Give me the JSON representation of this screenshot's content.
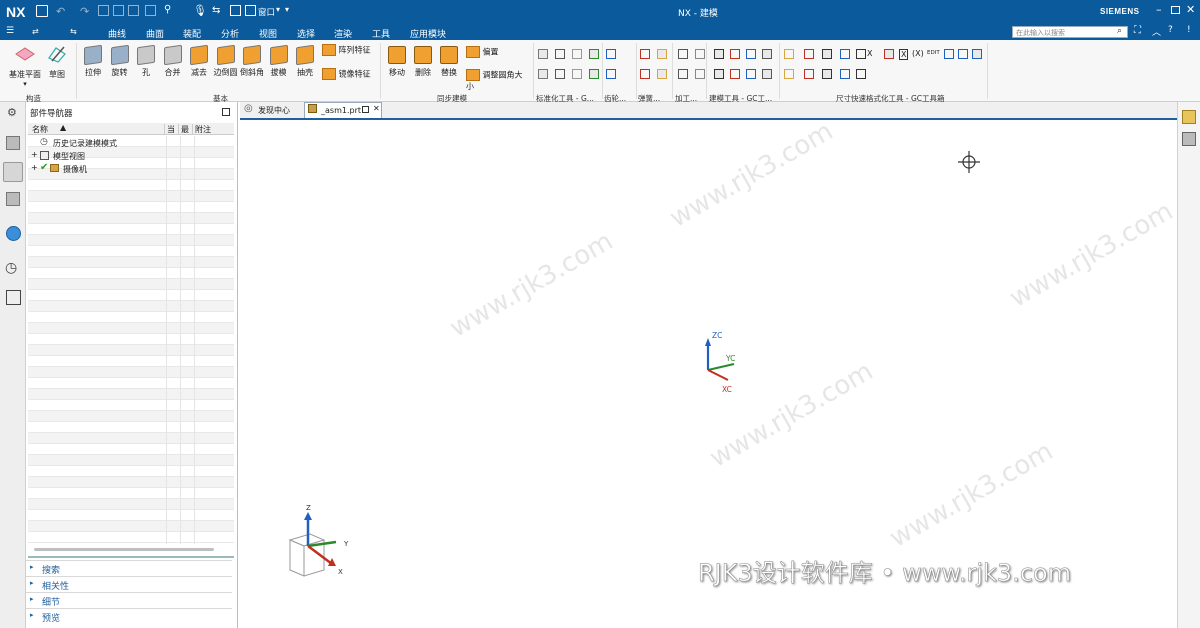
{
  "titlebar": {
    "logo": "NX",
    "title": "NX - 建模",
    "brand": "SIEMENS",
    "window_menu": "窗口"
  },
  "menubar": {
    "items": [
      "曲线",
      "曲面",
      "装配",
      "分析",
      "视图",
      "选择",
      "渲染",
      "工具",
      "应用模块"
    ],
    "search_placeholder": "在此输入以搜索"
  },
  "ribbon": {
    "datum": {
      "label": "基准平面"
    },
    "sketch": {
      "label": "草图"
    },
    "group_construct": "构造",
    "basic": [
      "拉伸",
      "旋转",
      "孔",
      "合并",
      "减去",
      "边倒圆",
      "倒斜角",
      "拔模",
      "抽壳"
    ],
    "pattern": "阵列特征",
    "mirror": "镜像特征",
    "group_basic": "基本",
    "sync": [
      "移动",
      "删除",
      "替换"
    ],
    "offset": "偏置",
    "resize_blend": "调整圆角大小",
    "group_sync": "同步建模",
    "group_std": "标准化工具 - G...",
    "group_gear": "齿轮...",
    "group_spring": "弹簧...",
    "group_machining": "加工...",
    "group_modeling_gc": "建模工具 - GC工...",
    "group_dim_gc": "尺寸快速格式化工具 - GC工具箱",
    "dim_labels": [
      "X",
      "(X)",
      "EDIT"
    ]
  },
  "tabs": [
    {
      "label": "发现中心"
    },
    {
      "label": "_asm1.prt"
    }
  ],
  "navigator": {
    "title": "部件导航器",
    "columns": [
      "名称",
      "当",
      "最",
      "附注"
    ],
    "rows": [
      {
        "label": "历史记录建模模式"
      },
      {
        "label": "模型视图"
      },
      {
        "label": "摄像机"
      }
    ],
    "sections": [
      "搜索",
      "相关性",
      "细节",
      "预览"
    ]
  },
  "viewport": {
    "triad_labels": {
      "zc": "ZC",
      "yc": "YC",
      "xc": "XC"
    },
    "view_triad": {
      "z": "Z",
      "y": "Y",
      "x": "X"
    }
  },
  "watermark": "RJK3设计软件库 • www.rjk3.com",
  "colors": {
    "titlebar": "#0a5a9c",
    "accent": "#1e5f9c",
    "sync_orange": "#f0a030"
  }
}
